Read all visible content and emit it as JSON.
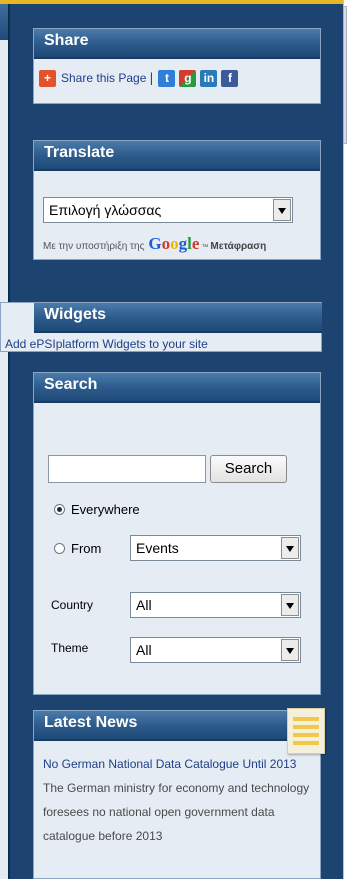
{
  "share": {
    "title": "Share",
    "link_label": "Share this Page",
    "separator": "|",
    "icons": [
      "share-plus-icon",
      "twitter-icon",
      "google-plus-icon",
      "linkedin-icon",
      "facebook-icon"
    ]
  },
  "translate": {
    "title": "Translate",
    "select_value": "Επιλογή γλώσσας",
    "powered_prefix": "Με την υποστήριξη της",
    "google_logo": "Google",
    "trademark": "™",
    "translate_word": "Μετάφραση"
  },
  "widgets": {
    "title": "Widgets",
    "link_label": "Add ePSIplatform Widgets to your site"
  },
  "search": {
    "title": "Search",
    "input_value": "",
    "button_label": "Search",
    "scope_everywhere": "Everywhere",
    "scope_from": "From",
    "selected_scope": "Everywhere",
    "from_value": "Events",
    "country_label": "Country",
    "country_value": "All",
    "theme_label": "Theme",
    "theme_value": "All"
  },
  "news": {
    "title": "Latest News",
    "item_title": "No German National Data Catalogue Until 2013",
    "item_excerpt": "The German ministry for economy and technology foresees no national open government data catalogue before 2013"
  },
  "colors": {
    "page_bg": "#1d4470",
    "top_bar": "#e8b822",
    "header_bg": "#2b5a8a",
    "box_bg": "#e5ecf3",
    "link": "#1f3f8a"
  }
}
